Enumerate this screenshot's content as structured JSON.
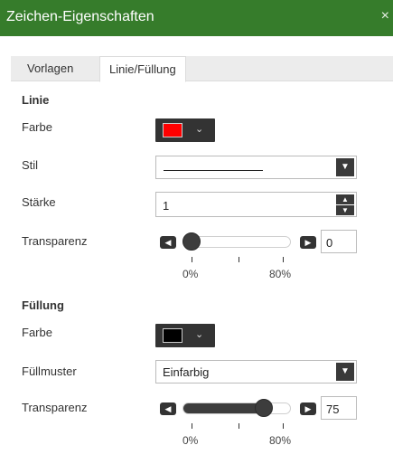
{
  "dialog": {
    "title": "Zeichen-Eigenschaften",
    "close_icon": "×"
  },
  "tabs": [
    {
      "label": "Vorlagen",
      "active": false
    },
    {
      "label": "Linie/Füllung",
      "active": true
    }
  ],
  "line": {
    "section_title": "Linie",
    "color_label": "Farbe",
    "color_value": "#ff0000",
    "style_label": "Stil",
    "width_label": "Stärke",
    "width_value": "1",
    "transparency_label": "Transparenz",
    "transparency_value": "0",
    "tick_min": "0%",
    "tick_max": "80%"
  },
  "fill": {
    "section_title": "Füllung",
    "color_label": "Farbe",
    "color_value": "#000000",
    "pattern_label": "Füllmuster",
    "pattern_value": "Einfarbig",
    "transparency_label": "Transparenz",
    "transparency_value": "75",
    "tick_min": "0%",
    "tick_max": "80%"
  }
}
